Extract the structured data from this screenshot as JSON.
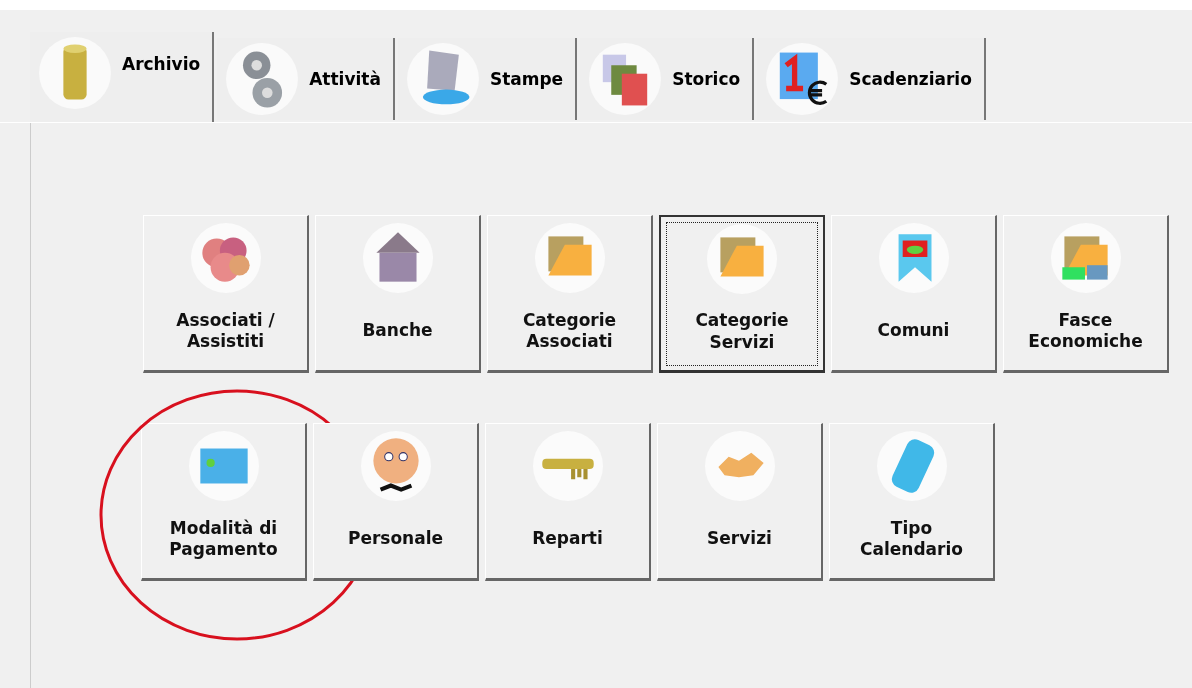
{
  "tabs": [
    {
      "label": "Archivio",
      "selected": true
    },
    {
      "label": "Attività",
      "selected": false
    },
    {
      "label": "Stampe",
      "selected": false
    },
    {
      "label": "Storico",
      "selected": false
    },
    {
      "label": "Scadenziario",
      "selected": false
    }
  ],
  "button_rows": [
    [
      {
        "label": "Associati /\nAssistiti",
        "focused": false,
        "circled": false
      },
      {
        "label": "Banche",
        "focused": false,
        "circled": false
      },
      {
        "label": "Categorie\nAssociati",
        "focused": false,
        "circled": false
      },
      {
        "label": "Categorie\nServizi",
        "focused": true,
        "circled": false
      },
      {
        "label": "Comuni",
        "focused": false,
        "circled": false
      },
      {
        "label": "Fasce\nEconomiche",
        "focused": false,
        "circled": false
      }
    ],
    [
      {
        "label": "Modalità di\nPagamento",
        "focused": false,
        "circled": true
      },
      {
        "label": "Personale",
        "focused": false,
        "circled": false
      },
      {
        "label": "Reparti",
        "focused": false,
        "circled": false
      },
      {
        "label": "Servizi",
        "focused": false,
        "circled": false
      },
      {
        "label": "Tipo\nCalendario",
        "focused": false,
        "circled": false
      }
    ]
  ]
}
